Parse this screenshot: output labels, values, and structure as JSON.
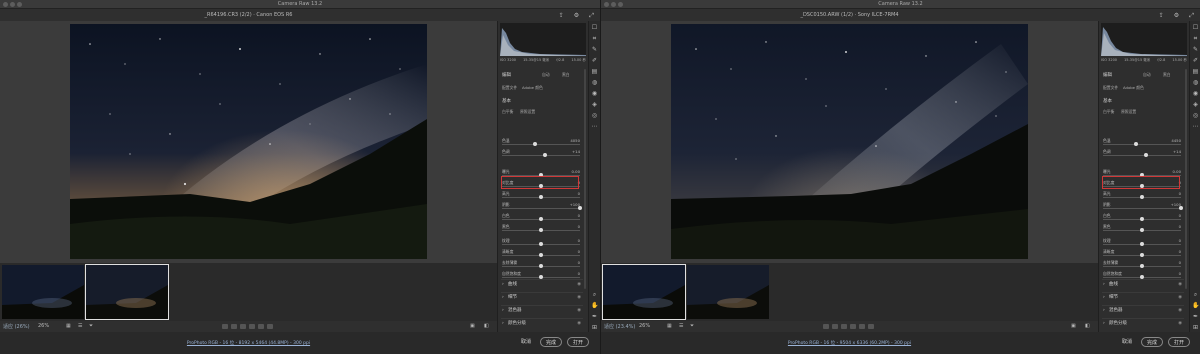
{
  "app_title": "Camera Raw 13.2",
  "left": {
    "file_title": "_R64196.CR3 (2/2) · Canon EOS R6",
    "exif": [
      "ISO 3200",
      "15-35@15 毫米",
      "f/2.8",
      "15.00 秒"
    ],
    "zoom_label": "适应 (26%)",
    "zoom_pct": "26%",
    "footer_link": "ProPhoto RGB - 16 位 - 8192 x 5464 (44.8MP) - 300 ppi",
    "exposure": "0.00",
    "temp": "4050",
    "tint": "+14",
    "highlight": "+100"
  },
  "right": {
    "file_title": "_DSC0150.ARW (1/2) · Sony ILCE-7RM4",
    "exif": [
      "ISO 3200",
      "15-35@15 毫米",
      "f/2.8",
      "15.00 秒"
    ],
    "zoom_label": "适应 (23.4%)",
    "zoom_pct": "26%",
    "footer_link": "ProPhoto RGB - 16 位 - 9504 x 6336 (60.2MP) - 300 ppi",
    "exposure": "0.00",
    "temp": "4450",
    "tint": "+14",
    "highlight": "+100"
  },
  "panel": {
    "edit_title": "编辑",
    "btn_auto": "自动",
    "btn_bw": "黑白",
    "profile_label": "配置文件",
    "profile_value": "Adobe 颜色",
    "basic_title": "基本",
    "wb_label": "白平衡",
    "wb_value": "原照设置",
    "sliders": [
      {
        "label": "色温",
        "key": "temp",
        "pos": 0.42
      },
      {
        "label": "色调",
        "key": "tint",
        "pos": 0.55
      },
      {
        "label": "曝光",
        "key": "exposure",
        "pos": 0.5
      },
      {
        "label": "对比度",
        "value": "0",
        "pos": 0.5
      },
      {
        "label": "高光",
        "value": "0",
        "pos": 0.5
      },
      {
        "label": "阴影",
        "key": "highlight",
        "pos": 1.0
      },
      {
        "label": "白色",
        "value": "0",
        "pos": 0.5
      },
      {
        "label": "黑色",
        "value": "0",
        "pos": 0.5
      },
      {
        "label": "纹理",
        "value": "0",
        "pos": 0.5
      },
      {
        "label": "清晰度",
        "value": "0",
        "pos": 0.5
      },
      {
        "label": "去除薄雾",
        "value": "0",
        "pos": 0.5
      },
      {
        "label": "自然饱和度",
        "value": "0",
        "pos": 0.5
      },
      {
        "label": "饱和度",
        "value": "0",
        "pos": 0.5
      }
    ],
    "sections": [
      "曲线",
      "细节",
      "混色器",
      "颜色分级"
    ]
  },
  "buttons": {
    "cancel": "取消",
    "done": "完成",
    "open": "打开"
  },
  "icons": [
    "crop-icon",
    "brush-icon",
    "heal-icon",
    "redeye-icon",
    "mask-icon",
    "preset-icon",
    "more-icon",
    "zoom-icon",
    "hand-icon",
    "sampler-icon",
    "grid-icon"
  ]
}
